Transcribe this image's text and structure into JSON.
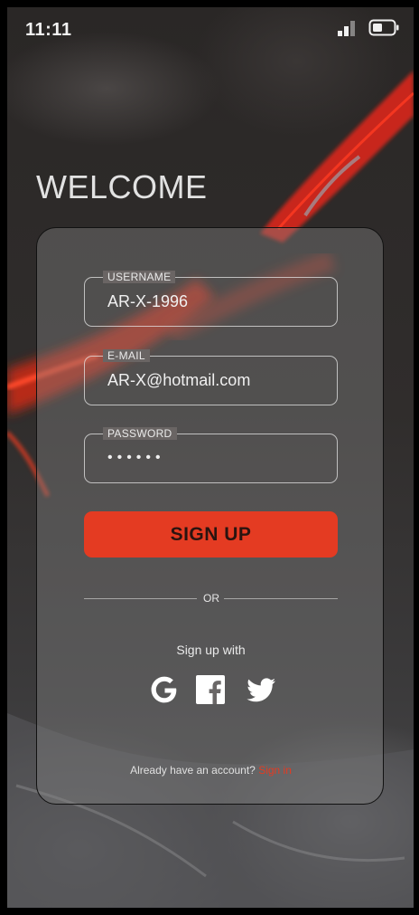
{
  "status_bar": {
    "time": "11:11"
  },
  "heading": "WELCOME",
  "form": {
    "username": {
      "label": "USERNAME",
      "value": "AR-X-1996"
    },
    "email": {
      "label": "E-MAIL",
      "value": "AR-X@hotmail.com"
    },
    "password": {
      "label": "PASSWORD",
      "value": "••••••"
    },
    "submit_label": "SIGN UP"
  },
  "divider_text": "OR",
  "social": {
    "prompt": "Sign up with",
    "providers": [
      "google-icon",
      "facebook-icon",
      "twitter-icon"
    ]
  },
  "footer": {
    "question": "Already have an account? ",
    "link": "Sign in"
  },
  "colors": {
    "accent": "#e43b22",
    "card": "#808080",
    "text": "#eaeaea"
  }
}
